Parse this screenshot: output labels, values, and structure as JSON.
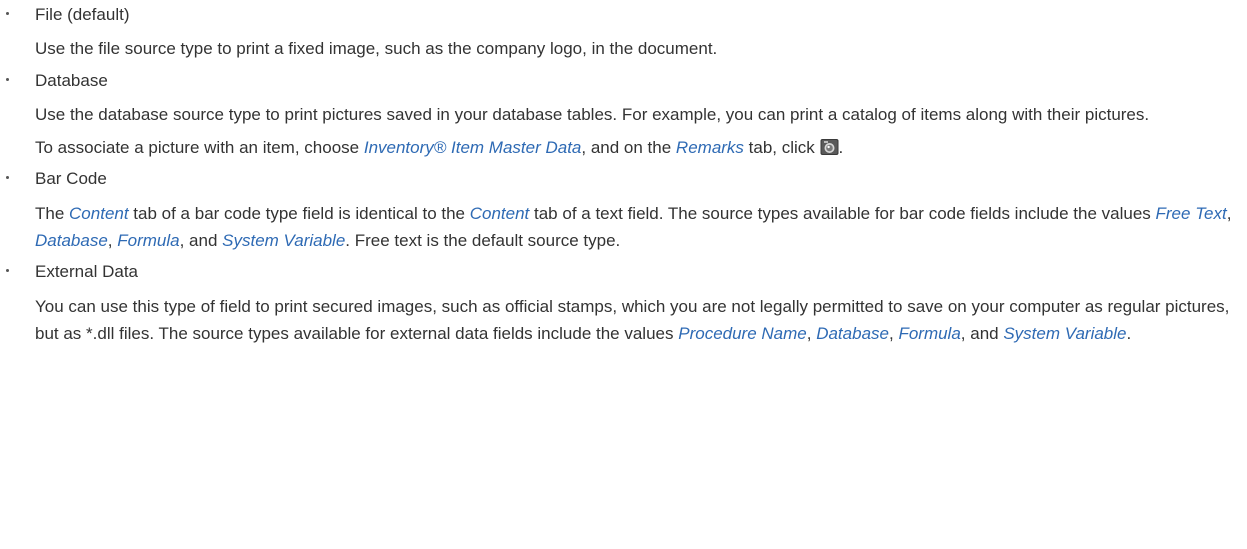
{
  "items": [
    {
      "label": "File (default)",
      "paragraphs": [
        [
          "Use the file source type to print a fixed image, such as the company logo, in the document."
        ]
      ]
    },
    {
      "label": "Database",
      "paragraphs": [
        [
          "Use the database source type to print pictures saved in your database tables. For example, you can print a catalog of items along with their pictures."
        ],
        [
          "To associate a picture with an item, choose ",
          "Inventory® Item Master Data",
          ", and on the ",
          "Remarks",
          " tab, click ",
          "."
        ]
      ]
    },
    {
      "label": "Bar Code",
      "paragraphs": [
        [
          "The ",
          "Content",
          " tab of a bar code type field is identical to the ",
          "Content",
          " tab of a text field. The source types available for bar code fields include the values ",
          "Free Text",
          ", ",
          "Database",
          ", ",
          "Formula",
          ", and ",
          "System Variable",
          ". Free text is the default source type."
        ]
      ]
    },
    {
      "label": "External Data",
      "paragraphs": [
        [
          "You can use this type of field to print secured images, such as official stamps, which you are not legally permitted to save on your computer as regular pictures, but as *.dll files. The source types available for external data fields include the values ",
          "Procedure Name",
          ", ",
          "Database",
          ", ",
          "Formula",
          ", and ",
          "System Variable",
          "."
        ]
      ]
    }
  ],
  "icons": {
    "camera": "camera-icon"
  },
  "colors": {
    "text": "#333333",
    "link": "#2e6ab4"
  }
}
